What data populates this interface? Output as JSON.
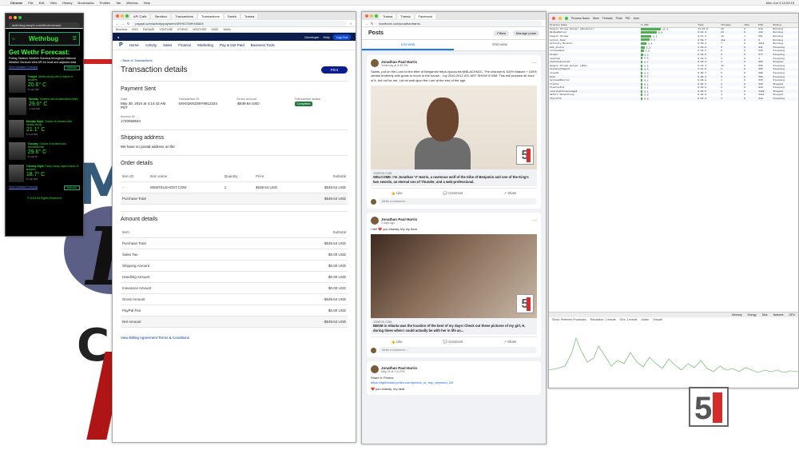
{
  "menubar": {
    "app": "Chrome",
    "items": [
      "File",
      "Edit",
      "View",
      "History",
      "Bookmarks",
      "Profiles",
      "Tab",
      "Window",
      "Help"
    ],
    "clock": "Mon Jun 3 10:03:15"
  },
  "weather": {
    "url": "wethrbug.lamp5.com/lib/wforecast/",
    "brand": "Wethrbug",
    "title": "Get Wethr Forecast:",
    "subtitle": "Polling Stations Weather Bureaus throughout National Weather Services Web API for local and adjacent data",
    "link": "Subscribe",
    "view_forecast": "View Detailed Forecast",
    "refresh": "Refresh",
    "periods": [
      {
        "name": "Tonight",
        "text": "Mostly cloudy with a chance of showers",
        "temp": "20.6° C",
        "wind": "6 mph SW"
      },
      {
        "name": "Monday",
        "text": "Showers and thunderstorms likely",
        "temp": "29.6° C",
        "wind": "7 mph SW"
      },
      {
        "name": "Monday Night",
        "text": "Chance of showers then mostly cloudy",
        "temp": "21.1° C",
        "wind": "5 mph SW"
      },
      {
        "name": "Tuesday",
        "text": "Chance of showers and thunderstorms",
        "temp": "29.6° C",
        "wind": "8 mph W"
      },
      {
        "name": "Tuesday Night",
        "text": "Partly cloudy, slight chance of showers",
        "temp": "18.7° C",
        "wind": "5 mph NW"
      }
    ],
    "footer": "© 2024 All Rights Reserved"
  },
  "paypal": {
    "tabs": [
      "API Calls",
      "Sandbox",
      "Transactions",
      "Transactions",
      "Faceb",
      "Transa"
    ],
    "url": "paypal.com/activity/payment/4RH91TA9KN0824",
    "bookmarks": [
      "Business",
      "EMS",
      "PARAMS",
      "YOUTUBE",
      "ETHNIC",
      "WEATHER",
      "WISE",
      "Wethr"
    ],
    "dev_label": "Developer",
    "dev_help": "Help",
    "dev_login": "Log Out",
    "nav": [
      "Home",
      "Activity",
      "Sales",
      "Finance",
      "Marketing",
      "Pay & Get Paid",
      "Business Tools"
    ],
    "back": "Back to Transactions",
    "title": "Transaction details",
    "print": "Print",
    "payment_heading": "Payment Sent",
    "date_label": "Date",
    "date_value": "May 30, 2024 at 4:14:43 AM PDT",
    "txid_label": "Transaction ID",
    "txid_value": "5XH31KN2S8Y6812324",
    "gross_label": "Gross amount",
    "gross_value": "-$539.64 USD",
    "status_label": "Transaction status",
    "status_value": "Completed",
    "invoice_label": "Invoice ID",
    "invoice_value": "1720059644",
    "shipping_heading": "Shipping address",
    "shipping_value": "We have no postal address on file",
    "order_heading": "Order details",
    "order_cols": [
      "Item ID",
      "Item name",
      "Quantity",
      "Price",
      "Subtotal"
    ],
    "order_rows": [
      [
        "-",
        "WEBTELEHOST.COM",
        "1",
        "$539.64 USD",
        "$539.64 USD"
      ]
    ],
    "purchase_total_label": "Purchase Total",
    "purchase_total_value": "$539.64 USD",
    "amount_heading": "Amount details",
    "amount_cols": [
      "Item",
      "Subtotal"
    ],
    "amount_rows": [
      [
        "Purchase Total",
        "-$539.64 USD"
      ],
      [
        "Sales Tax",
        "$0.00 USD"
      ],
      [
        "Shipping Amount",
        "$0.00 USD"
      ],
      [
        "Handling Amount",
        "$0.00 USD"
      ],
      [
        "Insurance Amount",
        "$0.00 USD"
      ],
      [
        "Gross Amount",
        "-$539.64 USD"
      ],
      [
        "PayPal Fee",
        "$0.00 USD"
      ]
    ],
    "net_label": "Net Amount",
    "net_value": "-$539.64 USD",
    "footer_link": "View Billing Agreement Terms & Conditions"
  },
  "facebook": {
    "tabs": [
      "Transa",
      "Transa",
      "Facebook"
    ],
    "url": "facebook.com/jonathanharris",
    "posts_title": "Posts",
    "filters": "Filters",
    "manage": "Manage posts",
    "list_view": "List view",
    "grid_view": "Grid view",
    "posts": [
      {
        "author": "Jonathan Paul Harris",
        "time": "Yesterday at 9:38 PM",
        "text": "Saints, put on the Lord for the tribe of Benjamin! https://youtu.be/@BLACKMJC. The channel is 100% Mature + 100% certain brotherly with goals to move in the house... my 2010-2012 ATL ART SHOW 9:30M. This will produce an hour of it, but not for me. Let us wait upon the Lord at the end of the age.",
        "domain": "JONFOX.COM",
        "link_title": "WELCOME: I'm Jonathan 'V' Harris, a ravenous wolf of the tribe of Benjamin and one of the King's two swords, an eternal son of Thunder, and a web-professional.",
        "like": "Like",
        "comment": "Comment",
        "share": "Share",
        "write": "Write a comment..."
      },
      {
        "author": "Jonathan Paul Harris",
        "time": "3 days ago",
        "text": "I still ❤️ you shawty, My my dear",
        "domain": "JONFOX.COM",
        "link_title": "BBSM in Atlanta was the location of the best of my days! Check out these pictures of my girl, H, during times when I could actually be with her in life an...",
        "like": "Like",
        "comment": "Comment",
        "share": "Share",
        "write": "Write a comment..."
      },
      {
        "author": "Jonathan Paul Harris",
        "time": "May 23 at 7:41 PM",
        "text": "Share it: Photos",
        "link": "https://lighthouse.jonfox.com/photos_or_mtp_keyword_24/",
        "extra": "❤️ you shawty, my dear"
      }
    ],
    "photo_badge": "5"
  },
  "activity": {
    "toolbar": [
      "Process Name",
      "Mem",
      "Threads",
      "Ports",
      "PID",
      "User"
    ],
    "columns": [
      "Process Name",
      "% CPU",
      "Time",
      "Threads",
      "Idle",
      "PID",
      "Status"
    ],
    "rows": [
      [
        "Google Chrome Helper (Renderer)",
        "12.4",
        "11:45.9",
        "28",
        "0",
        "812",
        "Running"
      ],
      [
        "WindowServer",
        "9.8",
        "8:22.3",
        "23",
        "0",
        "148",
        "Running"
      ],
      [
        "Google Chrome",
        "6.5",
        "4:11.2",
        "42",
        "1",
        "601",
        "Running"
      ],
      [
        "kernel_task",
        "5.1",
        "3:58.7",
        "312",
        "0",
        "0",
        "Running"
      ],
      [
        "Activity Monitor",
        "3.4",
        "0:58.4",
        "7",
        "0",
        "3011",
        "Running"
      ],
      [
        "mds_stores",
        "2.2",
        "1:03.0",
        "5",
        "0",
        "421",
        "Sleeping"
      ],
      [
        "coreaudiod",
        "1.8",
        "0:44.1",
        "9",
        "0",
        "243",
        "Sleeping"
      ],
      [
        "Finder",
        "1.1",
        "0:32.8",
        "6",
        "0",
        "577",
        "Sleeping"
      ],
      [
        "launchd",
        "0.9",
        "0:28.6",
        "4",
        "0",
        "1",
        "Sleeping"
      ],
      [
        "photoanalysisd",
        "0.7",
        "0:20.4",
        "3",
        "0",
        "980",
        "Stopped"
      ],
      [
        "Google Chrome Helper (GPU)",
        "0.6",
        "0:19.1",
        "12",
        "0",
        "655",
        "Sleeping"
      ],
      [
        "UserEventAgent",
        "0.4",
        "0:11.0",
        "2",
        "0",
        "356",
        "Sleeping"
      ],
      [
        "cloudd",
        "0.3",
        "0:09.7",
        "5",
        "0",
        "699",
        "Sleeping"
      ],
      [
        "Dock",
        "0.2",
        "0:06.3",
        "3",
        "0",
        "560",
        "Sleeping"
      ],
      [
        "SystemUIServer",
        "0.2",
        "0:05.8",
        "4",
        "0",
        "565",
        "Sleeping"
      ],
      [
        "trustd",
        "0.1",
        "0:04.2",
        "2",
        "0",
        "330",
        "Stopped"
      ],
      [
        "bluetoothd",
        "0.1",
        "0:03.9",
        "3",
        "0",
        "228",
        "Sleeping"
      ],
      [
        "spotlightknowledged",
        "0.1",
        "0:02.5",
        "2",
        "0",
        "1102",
        "Stopped"
      ],
      [
        "Safari Networking",
        "0.0",
        "0:01.8",
        "4",
        "0",
        "1221",
        "Stopped"
      ],
      [
        "cfprefsd",
        "0.0",
        "0:01.2",
        "3",
        "0",
        "312",
        "Sleeping"
      ]
    ],
    "graph_tabs": [
      "Memory",
      "Energy",
      "Disk",
      "Network",
      "GPU"
    ],
    "graph_opts": [
      "Show: Preferred Processes",
      "Resolution: 1 minute",
      "Grid: 1 minute",
      "Action",
      "Smooth"
    ]
  },
  "desk_badge": "5"
}
